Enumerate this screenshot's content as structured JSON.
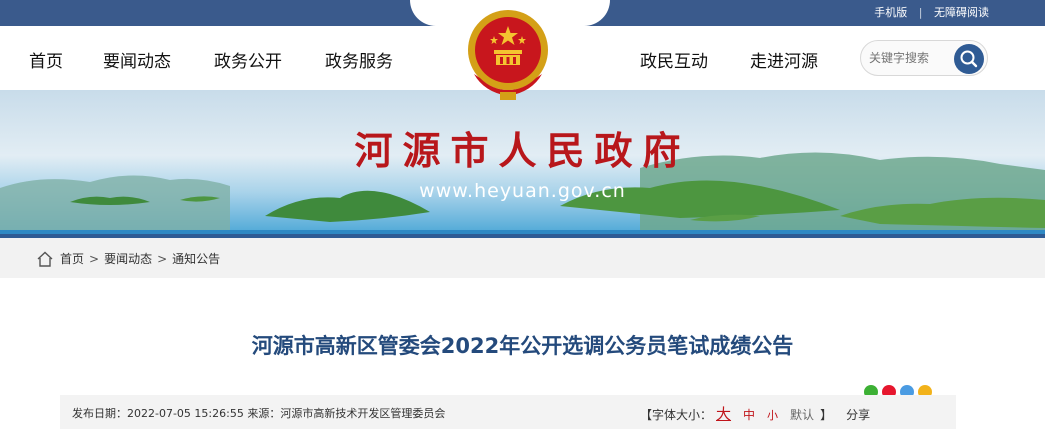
{
  "top_links": {
    "mobile": "手机版",
    "separator": "|",
    "accessible": "无障碍阅读"
  },
  "nav": {
    "left": [
      "首页",
      "要闻动态",
      "政务公开",
      "政务服务"
    ],
    "right": [
      "政民互动",
      "走进河源"
    ]
  },
  "search": {
    "placeholder": "关键字搜索"
  },
  "banner": {
    "title": "河源市人民政府",
    "url": "www.heyuan.gov.cn"
  },
  "breadcrumb": {
    "items": [
      "首页",
      "要闻动态",
      "通知公告"
    ],
    "separator": ">"
  },
  "article": {
    "title": "河源市高新区管委会2022年公开选调公务员笔试成绩公告",
    "meta": "发布日期：2022-07-05 15:26:55 来源：河源市高新技术开发区管理委员会",
    "font_size_label": "【字体大小：",
    "font_large": "大",
    "font_medium": "中",
    "font_small": "小",
    "font_default": "默认",
    "font_close": "】",
    "share_label": "分享"
  },
  "colors": {
    "top_bar": "#3a5a8c",
    "title_blue": "#244a7c",
    "banner_red": "#b8171b",
    "accent_red": "#c0141a"
  },
  "icons": {
    "emblem": "national-emblem",
    "search": "search-icon",
    "home": "home-icon",
    "share": [
      "wechat-icon",
      "weibo-icon",
      "qq-icon",
      "qzone-icon"
    ]
  }
}
